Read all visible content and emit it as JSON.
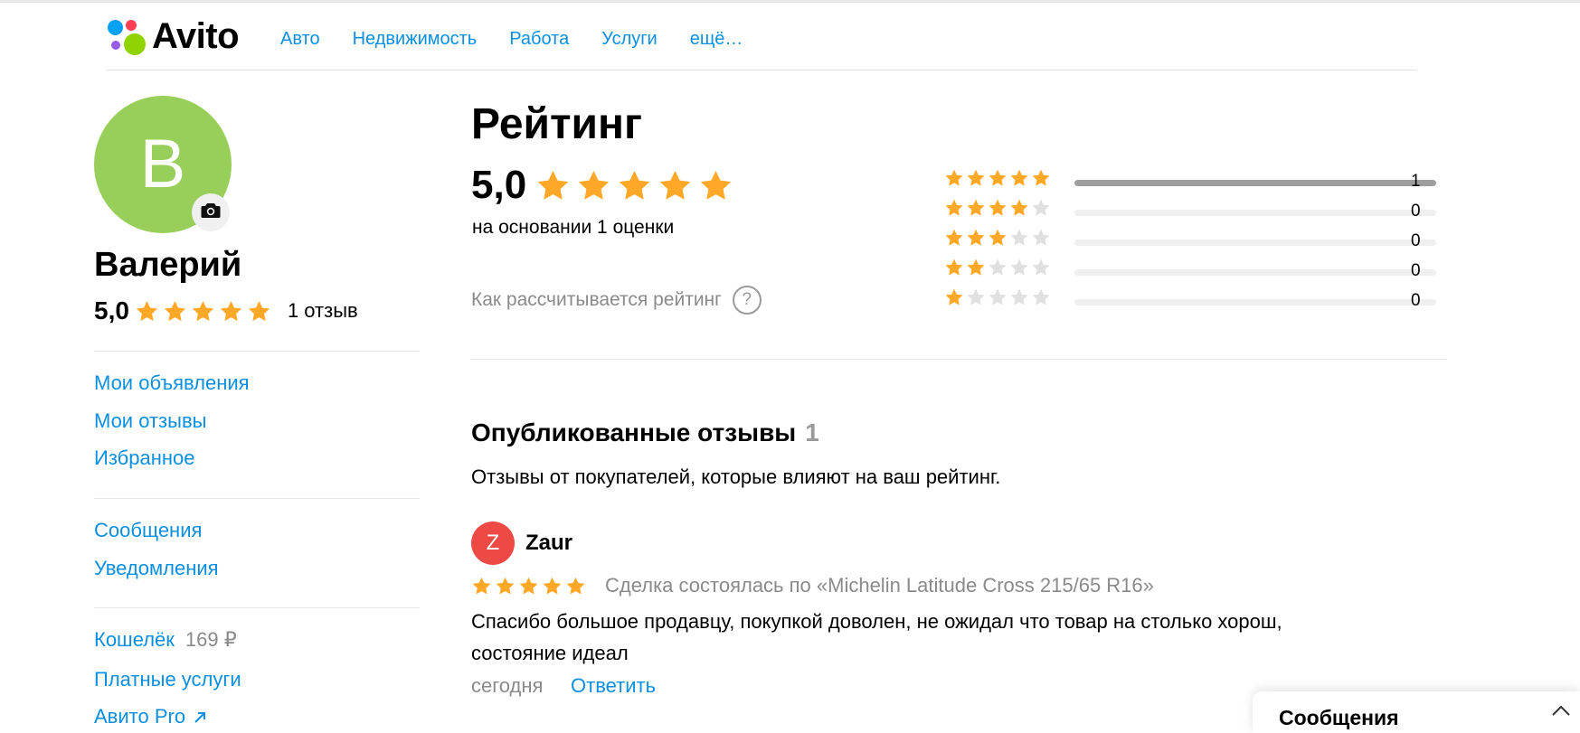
{
  "header": {
    "logo_text": "Avito",
    "nav": [
      "Авто",
      "Недвижимость",
      "Работа",
      "Услуги",
      "ещё…"
    ]
  },
  "profile": {
    "avatar_letter": "В",
    "name": "Валерий",
    "rating_value": "5,0",
    "reviews_count_label": "1 отзыв"
  },
  "sidebar": {
    "group1": [
      "Мои объявления",
      "Мои отзывы",
      "Избранное"
    ],
    "group2": [
      "Сообщения",
      "Уведомления"
    ],
    "wallet_label": "Кошелёк",
    "wallet_amount": "169 ₽",
    "paid_services": "Платные услуги",
    "avito_pro": "Авито Pro"
  },
  "rating": {
    "title": "Рейтинг",
    "value": "5,0",
    "stars": 5,
    "based_on": "на основании 1 оценки",
    "how_calculated": "Как рассчитывается рейтинг",
    "help_symbol": "?",
    "distribution": [
      {
        "stars": 5,
        "count": "1",
        "fill": 1.0
      },
      {
        "stars": 4,
        "count": "0",
        "fill": 0
      },
      {
        "stars": 3,
        "count": "0",
        "fill": 0
      },
      {
        "stars": 2,
        "count": "0",
        "fill": 0
      },
      {
        "stars": 1,
        "count": "0",
        "fill": 0
      }
    ]
  },
  "published": {
    "title": "Опубликованные отзывы",
    "count": "1",
    "subtitle": "Отзывы от покупателей, которые влияют на ваш рейтинг."
  },
  "review": {
    "avatar_letter": "Z",
    "author": "Zaur",
    "stars": 5,
    "deal": "Сделка состоялась по «Michelin Latitude Cross 215/65 R16»",
    "text": "Спасибо большое продавцу, покупкой доволен, не ожидал что товар на столько хорош, состояние идеал",
    "date": "сегодня",
    "reply": "Ответить"
  },
  "messages_panel": {
    "title": "Сообщения"
  },
  "colors": {
    "link": "#0a8fe0",
    "star": "#ffa726",
    "star_empty": "#e0e0e0",
    "avatar_user": "#97cf5a",
    "avatar_reviewer": "#ee4a45"
  }
}
